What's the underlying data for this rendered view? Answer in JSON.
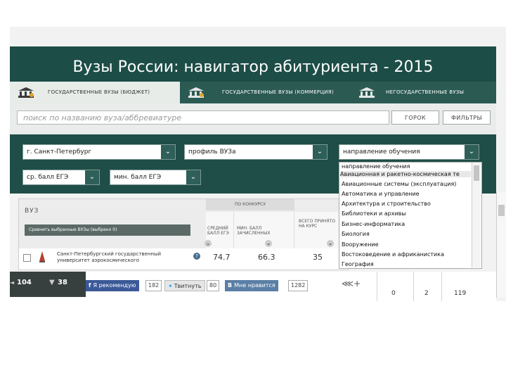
{
  "header": {
    "title": "Вузы России: навигатор абитуриента - 2015"
  },
  "tabs": [
    {
      "label": "ГОСУДАРСТВЕННЫЕ ВУЗЫ (БЮДЖЕТ)",
      "active": true
    },
    {
      "label": "ГОСУДАРСТВЕННЫЕ ВУЗЫ (КОММЕРЦИЯ)",
      "active": false
    },
    {
      "label": "НЕГОСУДАРСТВЕННЫЕ ВУЗЫ",
      "active": false
    }
  ],
  "search": {
    "placeholder": "поиск по названию вуза/аббревиатуре",
    "find_label": "ГОРОК",
    "filters_label": "ФИЛЬТРЫ"
  },
  "filters": {
    "city": "г. Санкт-Петербург",
    "profile": "профиль ВУЗа",
    "direction": "направление обучения",
    "avg_score": "ср. балл ЕГЭ",
    "min_score": "мин. балл ЕГЭ"
  },
  "direction_options": [
    "направление обучения",
    "Авиационная и ракетно-космическая те",
    "Авиационные системы (эксплуатация)",
    "Автоматика и управление",
    "Архитектура и строительство",
    "Библиотеки и архивы",
    "Бизнес-информатика",
    "Биология",
    "Вооружение",
    "Востоковедение и африканистика",
    "География"
  ],
  "table": {
    "vuz_header": "ВУЗ",
    "compare_button": "Сравнить выбранные ВУЗы (выбрано 0)",
    "group_header": "ПО КОНКУРСУ",
    "col_avg": "СРЕДНИЙ БАЛЛ ЕГЭ",
    "col_min": "МИН. БАЛЛ ЗАЧИСЛЕННЫХ",
    "col_total": "ВСЕГО ПРИНЯТО НА КУРС",
    "row": {
      "name": "Санкт-Петербургский государственный университет аэрокосмического",
      "avg": "74.7",
      "min": "66.3",
      "total": "35"
    }
  },
  "social": {
    "views": "104",
    "likes": "38",
    "fb_label": "Я рекомендую",
    "fb_count": "182",
    "tw_label": "Твитнуть",
    "tw_count": "80",
    "vk_label": "Мне нравится",
    "vk_count": "1282",
    "extra_values": [
      "0",
      "2",
      "119"
    ]
  },
  "colors": {
    "header": "#1d4d47",
    "tab_active_bg": "#e7ece8",
    "accent": "#2e5f58"
  }
}
